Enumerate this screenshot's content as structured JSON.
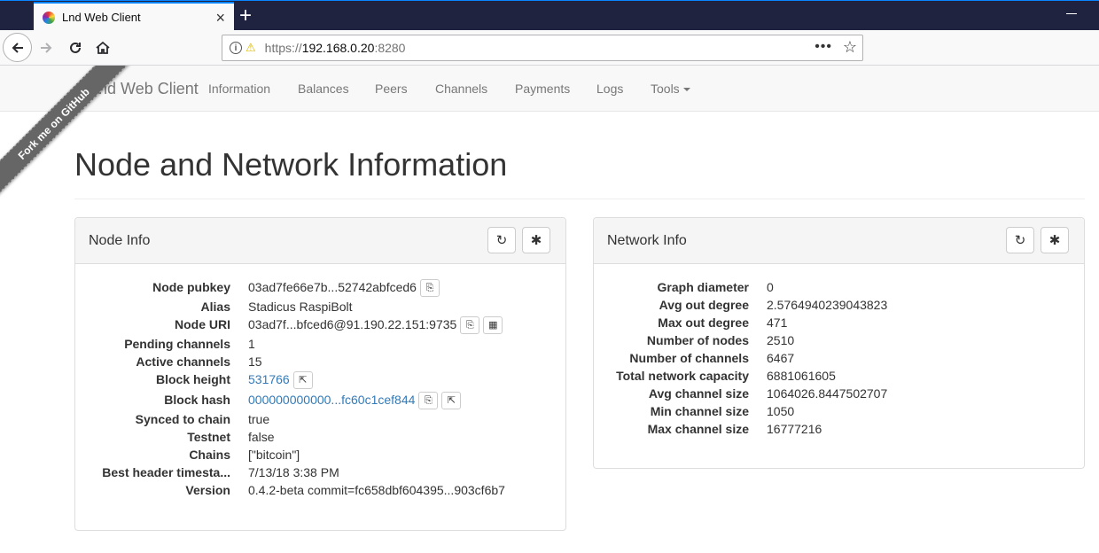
{
  "browser": {
    "tab_title": "Lnd Web Client",
    "url_proto": "https://",
    "url_host": "192.168.0.20",
    "url_port": ":8280",
    "icons": [
      "back-icon",
      "forward-icon",
      "reload-icon",
      "home-icon",
      "info-icon",
      "lock-warning-icon",
      "more-icon",
      "bookmark-star-icon"
    ]
  },
  "nav": {
    "brand": "Lnd Web Client",
    "items": [
      "Information",
      "Balances",
      "Peers",
      "Channels",
      "Payments",
      "Logs"
    ],
    "tools": "Tools"
  },
  "ribbon": "Fork me on GitHub",
  "page": {
    "title": "Node and Network Information"
  },
  "node_info": {
    "title": "Node Info",
    "rows": [
      {
        "label": "Node pubkey",
        "value": "03ad7fe66e7b...52742abfced6"
      },
      {
        "label": "Alias",
        "value": "Stadicus RaspiBolt"
      },
      {
        "label": "Node URI",
        "value": "03ad7f...bfced6@91.190.22.151:9735"
      },
      {
        "label": "Pending channels",
        "value": "1"
      },
      {
        "label": "Active channels",
        "value": "15"
      },
      {
        "label": "Block height",
        "value": "531766"
      },
      {
        "label": "Block hash",
        "value": "000000000000...fc60c1cef844"
      },
      {
        "label": "Synced to chain",
        "value": "true"
      },
      {
        "label": "Testnet",
        "value": "false"
      },
      {
        "label": "Chains",
        "value": "[\"bitcoin\"]"
      },
      {
        "label": "Best header timesta...",
        "value": "7/13/18 3:38 PM"
      },
      {
        "label": "Version",
        "value": "0.4.2-beta commit=fc658dbf604395...903cf6b7"
      }
    ]
  },
  "network_info": {
    "title": "Network Info",
    "rows": [
      {
        "label": "Graph diameter",
        "value": "0"
      },
      {
        "label": "Avg out degree",
        "value": "2.5764940239043823"
      },
      {
        "label": "Max out degree",
        "value": "471"
      },
      {
        "label": "Number of nodes",
        "value": "2510"
      },
      {
        "label": "Number of channels",
        "value": "6467"
      },
      {
        "label": "Total network capacity",
        "value": "6881061605"
      },
      {
        "label": "Avg channel size",
        "value": "1064026.8447502707"
      },
      {
        "label": "Min channel size",
        "value": "1050"
      },
      {
        "label": "Max channel size",
        "value": "16777216"
      }
    ]
  },
  "colors": {
    "link": "#337ab7",
    "tabbar": "#202340",
    "navbar": "#f8f8f8",
    "ribbon": "#666666"
  }
}
